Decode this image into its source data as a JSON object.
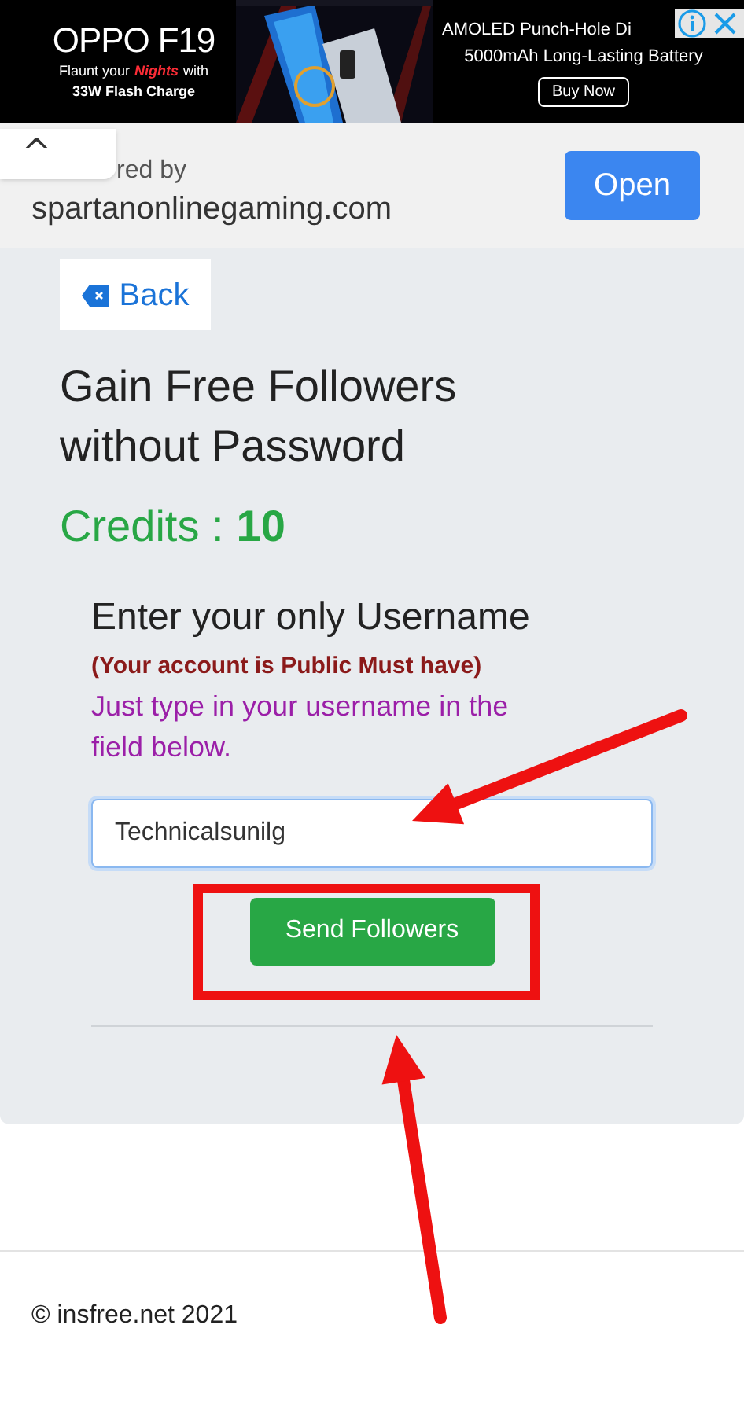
{
  "ad": {
    "headline": "OPPO F19",
    "tagline": [
      "Flaunt your",
      "Nights",
      "with"
    ],
    "subline": "33W Flash Charge",
    "features": [
      "AMOLED Punch-Hole Di",
      "5000mAh Long-Lasting Battery"
    ],
    "button": "Buy Now"
  },
  "sponsor": {
    "collapse": "^",
    "label": "red by",
    "domain": "spartanonlinegaming.com",
    "button": "Open"
  },
  "back": {
    "label": "Back"
  },
  "title": [
    "Gain Free Followers",
    "without Password"
  ],
  "credits": {
    "label": "Credits :",
    "value": "10"
  },
  "form": {
    "heading": "Enter your only Username",
    "warning": "(Your account is Public Must have)",
    "instruction": "Just type in your username in the field below.",
    "username": {
      "value": "Technicalsunilg",
      "focused": true
    },
    "button": "Send Followers"
  },
  "footer": "© insfree.net 2021",
  "annotations": [
    {
      "kind": "arrow"
    },
    {
      "kind": "box"
    },
    {
      "kind": "arrow"
    }
  ]
}
